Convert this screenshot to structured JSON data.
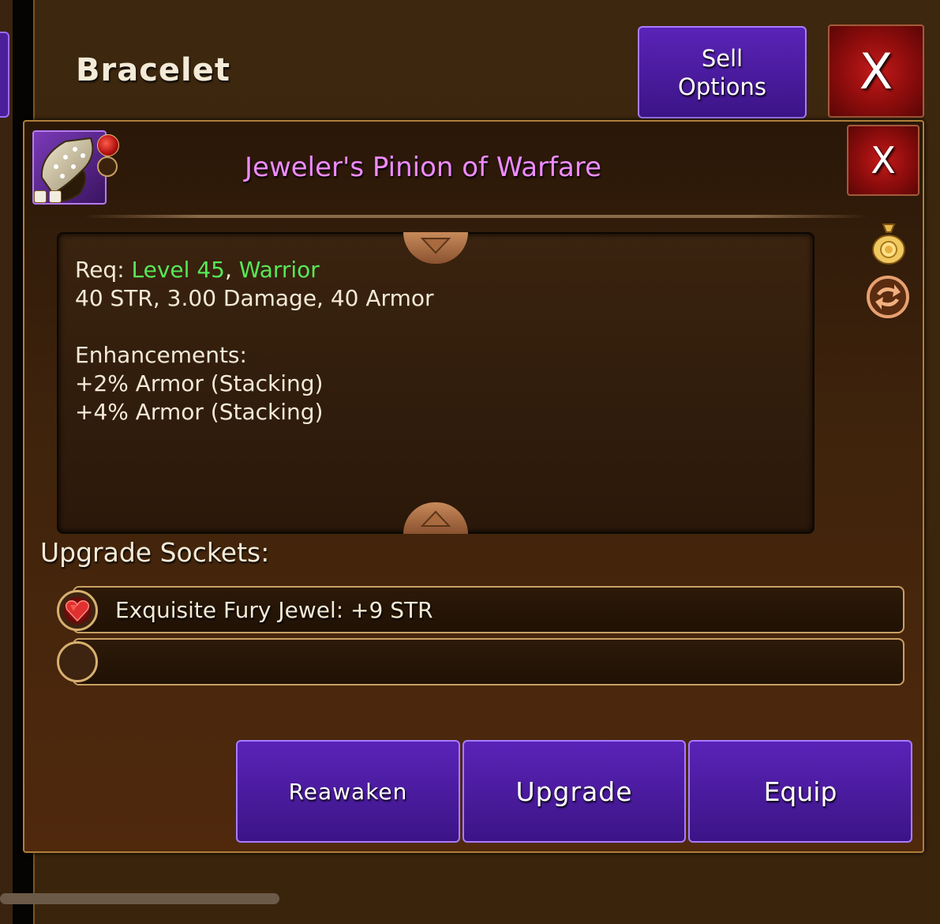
{
  "window": {
    "title": "Bracelet",
    "sell_options_line1": "Sell",
    "sell_options_line2": "Options",
    "close_label": "X"
  },
  "item": {
    "name": "Jeweler's Pinion of Warfare",
    "close_label": "X",
    "name_color": "#ee8bff"
  },
  "description": {
    "req_prefix": "Req: ",
    "level": "Level 45",
    "separator": ", ",
    "class": "Warrior",
    "stats": "40 STR, 3.00 Damage, 40 Armor",
    "enhancements_label": "Enhancements:",
    "enhancements": [
      "+2% Armor (Stacking)",
      "+4% Armor (Stacking)"
    ]
  },
  "sockets": {
    "label": "Upgrade Sockets:",
    "items": [
      {
        "text": "Exquisite Fury Jewel: +9 STR",
        "gem": "red-heart-jewel-icon"
      },
      {
        "text": "",
        "gem": "empty-socket-icon"
      }
    ]
  },
  "actions": {
    "reawaken": "Reawaken",
    "upgrade": "Upgrade",
    "equip": "Equip"
  },
  "icons": {
    "sell": "coin-bag-icon",
    "swap": "swap-arrows-icon"
  },
  "colors": {
    "button_purple": "#4a1ca0",
    "close_red": "#a81212",
    "requirement_green": "#57e857"
  }
}
